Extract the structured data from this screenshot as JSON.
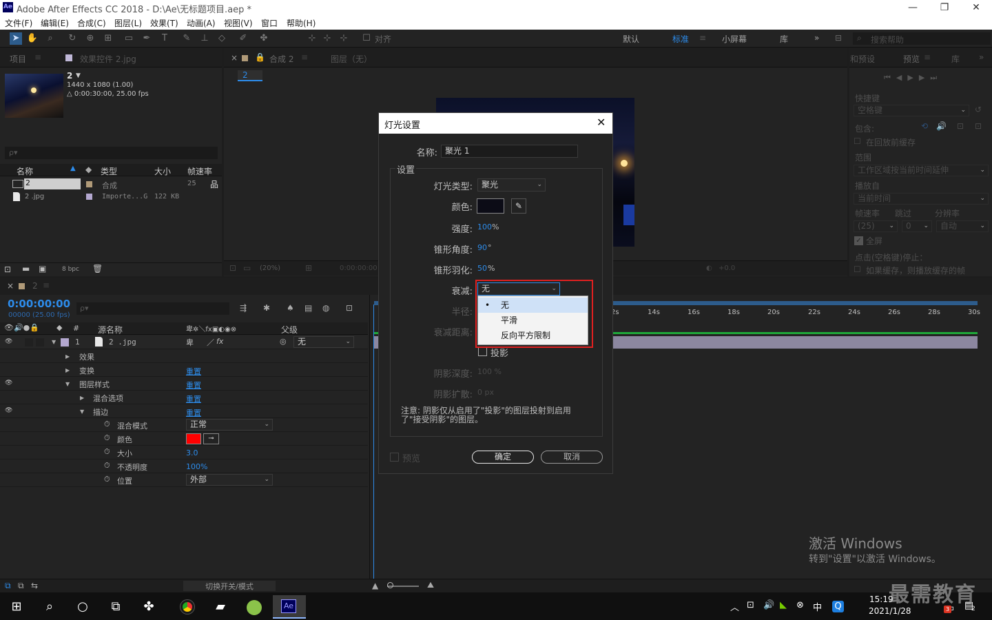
{
  "window": {
    "title": "Adobe After Effects CC 2018 - D:\\Ae\\无标题项目.aep *",
    "logo": "Ae"
  },
  "menu": [
    "文件(F)",
    "编辑(E)",
    "合成(C)",
    "图层(L)",
    "效果(T)",
    "动画(A)",
    "视图(V)",
    "窗口",
    "帮助(H)"
  ],
  "toolbar": {
    "snap_label": "对齐",
    "workspaces": [
      "默认",
      "标准",
      "小屏幕",
      "库"
    ],
    "active_workspace": "标准",
    "search_placeholder": "搜索帮助"
  },
  "project": {
    "tab_label": "项目",
    "effects_tab": "效果控件 2.jpg",
    "comp_name": "2",
    "comp_size": "1440 x 1080 (1.00)",
    "comp_duration": "△ 0:00:30:00, 25.00 fps",
    "search_placeholder": "ρ▾",
    "columns": [
      "名称",
      "类型",
      "大小",
      "帧速率"
    ],
    "items": [
      {
        "name": "2",
        "type": "合成",
        "size": "",
        "fps": "25",
        "color": "#b09a78"
      },
      {
        "name": "2 .jpg",
        "type": "Importe...G",
        "size": "122 KB",
        "fps": "",
        "color": "#b4a8d0"
      }
    ],
    "bpc": "8 bpc"
  },
  "viewer": {
    "comp_tab": "合成 2",
    "layer_tab": "图层（无）",
    "breadcrumb": "2",
    "zoom": "(20%)",
    "timecode": "0:00:00:00",
    "exposure": "+0.0"
  },
  "right_panel": {
    "tab_effects": "和预设",
    "tab_preview": "预览",
    "tab_lib": "库",
    "shortcut_label": "快捷键",
    "shortcut_value": "空格键",
    "include_label": "包含:",
    "cache_label": "在回放前缓存",
    "range_label": "范围",
    "range_value": "工作区域按当前时间延伸",
    "play_from_label": "播放自",
    "play_from_value": "当前时间",
    "fps_label": "帧速率",
    "skip_label": "跳过",
    "res_label": "分辨率",
    "fps_value": "(25)",
    "skip_value": "0",
    "res_value": "自动",
    "fullscreen_label": "全屏",
    "stop_label": "点击(空格键)停止：",
    "stop_option": "如果缓存，则播放缓存的帧"
  },
  "timeline": {
    "tab": "2",
    "timecode": "0:00:00:00",
    "timecode_sub": "00000 (25.00 fps)",
    "search_placeholder": "ρ▾",
    "col_source": "源名称",
    "col_parent": "父级",
    "col_num": "#",
    "layer": {
      "num": "1",
      "name": "2 .jpg",
      "parent": "无"
    },
    "rows": [
      {
        "label": "效果",
        "value": ""
      },
      {
        "label": "变换",
        "value": "重置"
      },
      {
        "label": "图层样式",
        "value": "重置"
      },
      {
        "label": "混合选项",
        "value": "重置"
      },
      {
        "label": "描边",
        "value": "重置"
      },
      {
        "label": "混合模式",
        "value": "正常"
      },
      {
        "label": "颜色",
        "value": ""
      },
      {
        "label": "大小",
        "value": "3.0"
      },
      {
        "label": "不透明度",
        "value": "100%"
      },
      {
        "label": "位置",
        "value": "外部"
      }
    ],
    "ruler": [
      "2s",
      "14s",
      "16s",
      "18s",
      "20s",
      "22s",
      "24s",
      "26s",
      "28s",
      "30s"
    ],
    "stroke_color": "#ff0000",
    "toggle_label": "切换开关/模式"
  },
  "dialog": {
    "title": "灯光设置",
    "name_label": "名称:",
    "name_value": "聚光 1",
    "settings_label": "设置",
    "type_label": "灯光类型:",
    "type_value": "聚光",
    "color_label": "颜色:",
    "intensity_label": "强度:",
    "intensity_value": "100",
    "intensity_unit": "%",
    "cone_label": "锥形角度:",
    "cone_value": "90",
    "cone_unit": "°",
    "feather_label": "锥形羽化:",
    "feather_value": "50",
    "feather_unit": "%",
    "falloff_label": "衰减:",
    "falloff_value": "无",
    "radius_label": "半径:",
    "falloff_dist_label": "衰减距离:",
    "shadow_label": "投影",
    "shadow_depth_label": "阴影深度:",
    "shadow_depth_value": "100 %",
    "shadow_spread_label": "阴影扩散:",
    "shadow_spread_value": "0 px",
    "note": "注意: 阴影仅从启用了\"投影\"的图层投射到启用了\"接受阴影\"的图层。",
    "preview_label": "预览",
    "ok_label": "确定",
    "cancel_label": "取消",
    "light_color": "#0c0c16"
  },
  "falloff_menu": {
    "options": [
      "无",
      "平滑",
      "反向平方限制"
    ],
    "selected": "无"
  },
  "watermark": {
    "line1": "激活 Windows",
    "line2": "转到\"设置\"以激活 Windows。",
    "brand": "最需教育"
  },
  "taskbar": {
    "time": "15:19",
    "date": "2021/1/28",
    "ime": "中",
    "notif": "2",
    "badge": "3"
  }
}
